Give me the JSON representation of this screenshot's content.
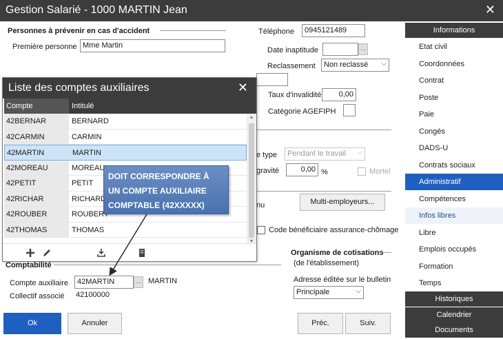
{
  "window": {
    "title": "Gestion Salarié - 1000 MARTIN Jean"
  },
  "accident": {
    "section_title": "Personnes à prévenir en cas d'accident",
    "first_person_label": "Première personne",
    "first_person_value": "Mme Martin",
    "phone_label": "Téléphone",
    "phone_value": "0945121489"
  },
  "health": {
    "inaptitude_label": "Date inaptitude",
    "inaptitude_value": "",
    "reclassement_label": "Reclassement",
    "reclassement_value": "Non reclassé",
    "invalidity_label": "Taux d'invalidité",
    "invalidity_value": "0,00",
    "agefiph_label": "Catégorie AGEFIPH"
  },
  "accident_type": {
    "type_label": "e type",
    "type_value": "Pendant le travail",
    "gravity_label": "gravité",
    "gravity_value": "0,00",
    "gravity_unit": "%",
    "mortel_label": "Mortel"
  },
  "multi": {
    "label_fragment": "nu",
    "button_label": "Multi-employeurs..."
  },
  "chomage": {
    "label": "Code bénéficiaire assurance-chômage"
  },
  "organisme": {
    "title": "Organisme de cotisations",
    "subtitle": "(de l'établissement)",
    "address_label": "Adresse éditée sur le bulletin",
    "address_value": "Principale"
  },
  "comptabilite": {
    "section_title": "Comptabilité",
    "account_label": "Compte auxiliaire",
    "account_value": "42MARTIN",
    "account_name": "MARTIN",
    "collectif_label": "Collectif associé",
    "collectif_value": "42100000"
  },
  "buttons": {
    "ok": "Ok",
    "cancel": "Annuler",
    "prev": "Préc.",
    "next": "Suiv."
  },
  "popup": {
    "title": "Liste des comptes auxiliaires",
    "col_account": "Compte",
    "col_title": "Intitulé",
    "rows": [
      {
        "account": "42BERNAR",
        "title": "BERNARD"
      },
      {
        "account": "42CARMIN",
        "title": "CARMIN"
      },
      {
        "account": "42MARTIN",
        "title": "MARTIN"
      },
      {
        "account": "42MOREAU",
        "title": "MOREAU"
      },
      {
        "account": "42PETIT",
        "title": "PETIT"
      },
      {
        "account": "42RICHAR",
        "title": "RICHARD"
      },
      {
        "account": "42ROUBER",
        "title": "ROUBERT"
      },
      {
        "account": "42THOMAS",
        "title": "THOMAS"
      }
    ],
    "selected_index": 2
  },
  "callout": {
    "line1": "DOIT CORRESPONDRE À",
    "line2": "UN COMPTE AUXILIAIRE",
    "line3": "COMPTABLE (42XXXXX)"
  },
  "sidebar": {
    "header": "Informations",
    "items": [
      {
        "label": "Etat civil"
      },
      {
        "label": "Coordonnées"
      },
      {
        "label": "Contrat"
      },
      {
        "label": "Poste"
      },
      {
        "label": "Paie"
      },
      {
        "label": "Congés"
      },
      {
        "label": "DADS-U"
      },
      {
        "label": "Contrats sociaux"
      },
      {
        "label": "Administratif"
      },
      {
        "label": "Compétences"
      },
      {
        "label": "Infos libres"
      },
      {
        "label": "Libre"
      },
      {
        "label": "Emplois occupés"
      },
      {
        "label": "Formation"
      },
      {
        "label": "Temps"
      }
    ],
    "active_item": "Administratif",
    "sub_items": [
      {
        "label": "Historiques"
      },
      {
        "label": "Calendrier"
      },
      {
        "label": "Documents"
      }
    ]
  },
  "colors": {
    "accent": "#1f5fbf",
    "titlebar": "#3c3c3c",
    "callout": "#5a80bb",
    "selection": "#cde4f7"
  }
}
